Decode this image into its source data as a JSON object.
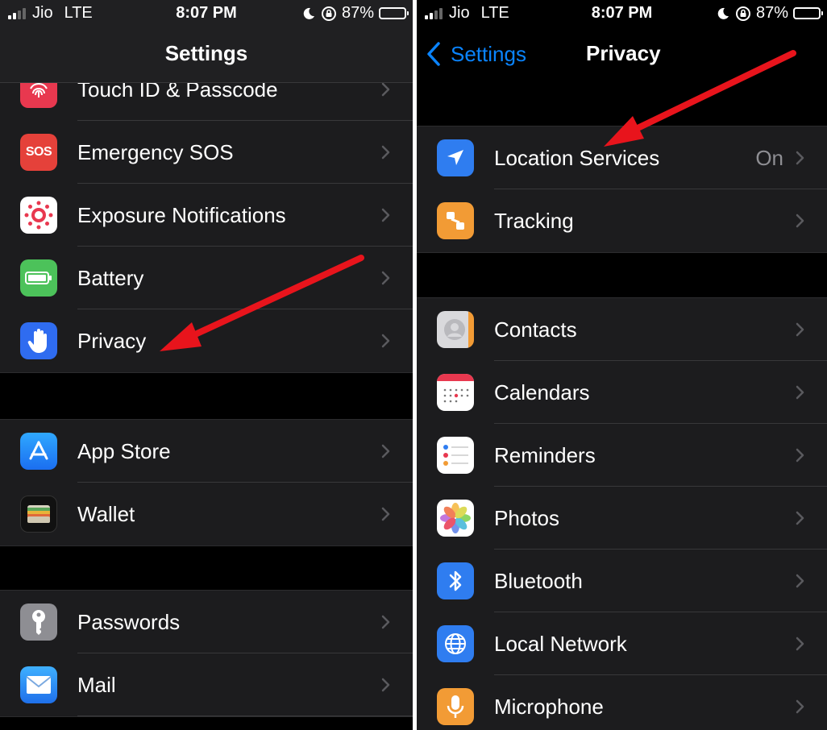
{
  "status": {
    "carrier": "Jio",
    "network": "LTE",
    "time": "8:07 PM",
    "battery": "87%"
  },
  "left": {
    "title": "Settings",
    "groups": [
      [
        {
          "label": "Touch ID & Passcode",
          "icon": "fingerprint-icon",
          "color": "#e8384f"
        },
        {
          "label": "Emergency SOS",
          "icon": "sos-icon",
          "color": "#e5413a"
        },
        {
          "label": "Exposure Notifications",
          "icon": "exposure-icon",
          "color": "#ffffff"
        },
        {
          "label": "Battery",
          "icon": "battery-icon",
          "color": "#4cc25a"
        },
        {
          "label": "Privacy",
          "icon": "hand-icon",
          "color": "#2f6cf0"
        }
      ],
      [
        {
          "label": "App Store",
          "icon": "app-store-icon",
          "color": "#1e90ff"
        },
        {
          "label": "Wallet",
          "icon": "wallet-icon",
          "color": "#111111"
        }
      ],
      [
        {
          "label": "Passwords",
          "icon": "key-icon",
          "color": "#8e8e93"
        },
        {
          "label": "Mail",
          "icon": "mail-icon",
          "color": "#2f8cf0"
        }
      ]
    ]
  },
  "right": {
    "back_label": "Settings",
    "title": "Privacy",
    "groups": [
      [
        {
          "label": "Location Services",
          "value": "On",
          "icon": "location-arrow-icon",
          "color": "#2f7df0"
        },
        {
          "label": "Tracking",
          "icon": "tracking-icon",
          "color": "#f29b35"
        }
      ],
      [
        {
          "label": "Contacts",
          "icon": "contacts-icon",
          "color": "#c8c8cc"
        },
        {
          "label": "Calendars",
          "icon": "calendar-icon",
          "color": "#ffffff"
        },
        {
          "label": "Reminders",
          "icon": "reminders-icon",
          "color": "#ffffff"
        },
        {
          "label": "Photos",
          "icon": "photos-icon",
          "color": "#ffffff"
        },
        {
          "label": "Bluetooth",
          "icon": "bluetooth-icon",
          "color": "#2f7df0"
        },
        {
          "label": "Local Network",
          "icon": "globe-icon",
          "color": "#2f7df0"
        },
        {
          "label": "Microphone",
          "icon": "microphone-icon",
          "color": "#f29b35"
        }
      ]
    ]
  }
}
